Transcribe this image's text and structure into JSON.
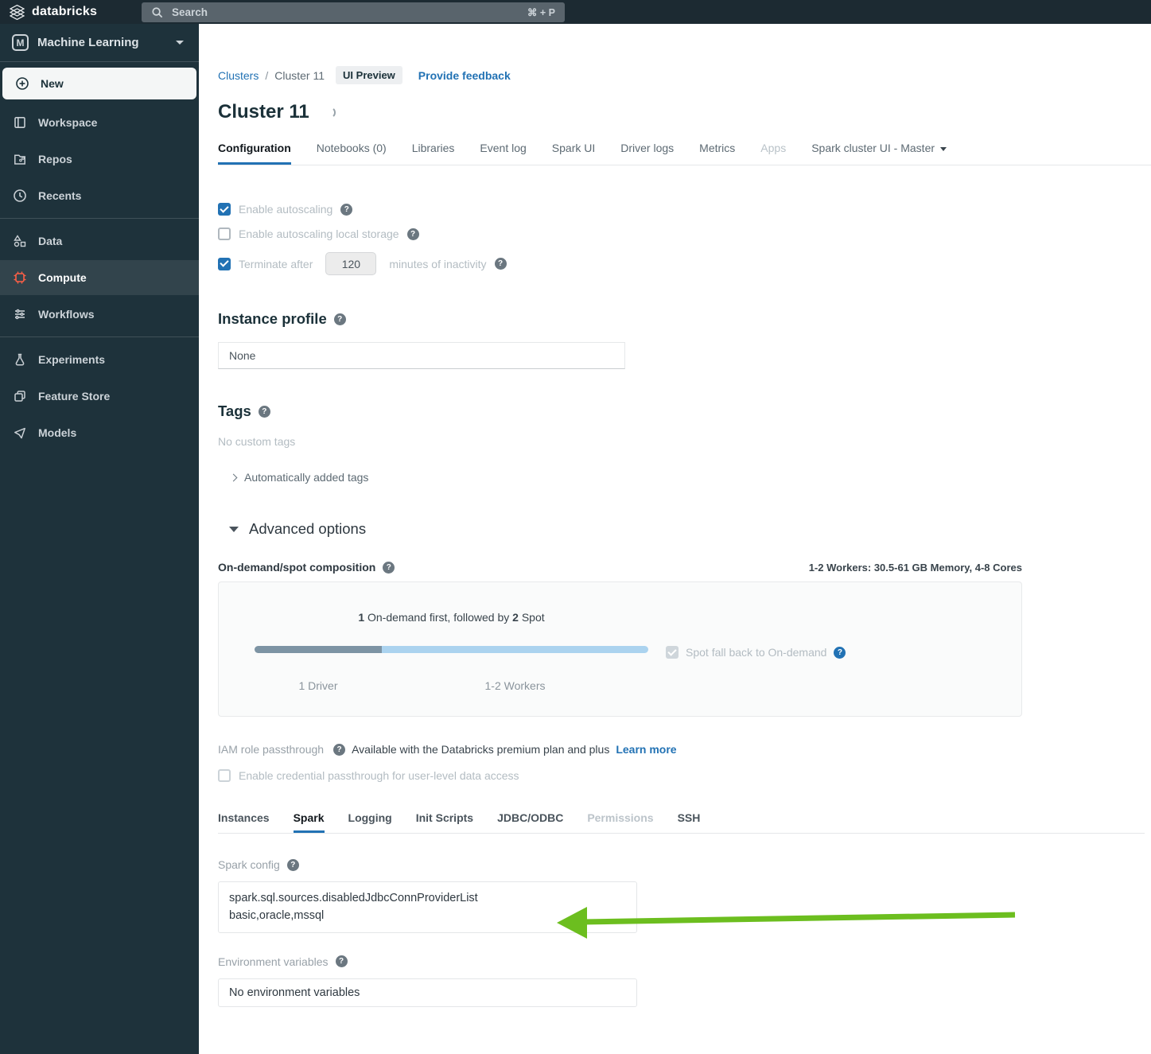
{
  "topbar": {
    "brand": "databricks",
    "search": {
      "placeholder": "Search",
      "shortcut": "⌘ + P"
    }
  },
  "sidebar": {
    "switcher": {
      "badge": "M",
      "label": "Machine Learning"
    },
    "items": [
      {
        "label": "New"
      },
      {
        "label": "Workspace"
      },
      {
        "label": "Repos"
      },
      {
        "label": "Recents"
      },
      {
        "label": "Data"
      },
      {
        "label": "Compute"
      },
      {
        "label": "Workflows"
      },
      {
        "label": "Experiments"
      },
      {
        "label": "Feature Store"
      },
      {
        "label": "Models"
      }
    ]
  },
  "breadcrumb": {
    "root": "Clusters",
    "separator": "/",
    "current": "Cluster 11",
    "badge": "UI Preview",
    "feedback": "Provide feedback"
  },
  "page": {
    "title": "Cluster 11"
  },
  "tabs": [
    {
      "label": "Configuration"
    },
    {
      "label": "Notebooks (0)"
    },
    {
      "label": "Libraries"
    },
    {
      "label": "Event log"
    },
    {
      "label": "Spark UI"
    },
    {
      "label": "Driver logs"
    },
    {
      "label": "Metrics"
    },
    {
      "label": "Apps"
    },
    {
      "label": "Spark cluster UI - Master"
    }
  ],
  "autoscaling": {
    "enable_label": "Enable autoscaling",
    "local_storage_label": "Enable autoscaling local storage",
    "terminate_prefix": "Terminate after",
    "terminate_value": "120",
    "terminate_suffix": "minutes of inactivity"
  },
  "instance_profile": {
    "heading": "Instance profile",
    "value": "None"
  },
  "tags": {
    "heading": "Tags",
    "empty": "No custom tags",
    "auto": "Automatically added tags"
  },
  "advanced": {
    "heading": "Advanced options",
    "spot": {
      "label": "On-demand/spot composition",
      "summary": "1-2 Workers: 30.5-61 GB Memory, 4-8 Cores",
      "ondemand_count": "1",
      "mid_text": "On-demand first, followed by",
      "spot_count": "2",
      "end_text": "Spot",
      "driver_label": "1 Driver",
      "workers_label": "1-2 Workers",
      "fallback_label": "Spot fall back to On-demand"
    },
    "iam": {
      "label": "IAM role passthrough",
      "note": "Available with the Databricks premium plan and plus",
      "link": "Learn more",
      "credential_label": "Enable credential passthrough for user-level data access"
    }
  },
  "subtabs": [
    {
      "label": "Instances"
    },
    {
      "label": "Spark"
    },
    {
      "label": "Logging"
    },
    {
      "label": "Init Scripts"
    },
    {
      "label": "JDBC/ODBC"
    },
    {
      "label": "Permissions"
    },
    {
      "label": "SSH"
    }
  ],
  "spark": {
    "config_label": "Spark config",
    "config_value": "spark.sql.sources.disabledJdbcConnProviderList\nbasic,oracle,mssql",
    "env_label": "Environment variables",
    "env_value": "No environment variables"
  },
  "colors": {
    "accent_blue": "#2272b4",
    "arrow_green": "#6cbe1f",
    "compute_red": "#ff5f46"
  }
}
